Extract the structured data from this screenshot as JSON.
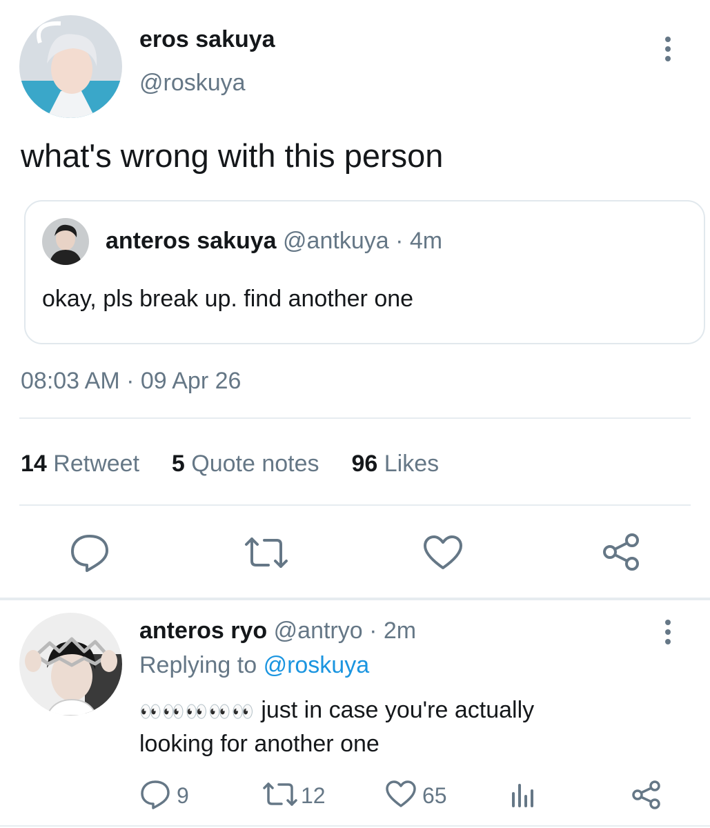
{
  "main_tweet": {
    "display_name": "eros sakuya",
    "handle": "@roskuya",
    "text": "what's wrong with this person",
    "quoted": {
      "display_name": "anteros sakuya",
      "handle": "@antkuya",
      "time_sep": "·",
      "time": "4m",
      "text": "okay, pls break up. find another one"
    },
    "timestamp": "08:03 AM · 09 Apr 26",
    "stats": {
      "retweets_count": "14",
      "retweets_label": "Retweet",
      "quotes_count": "5",
      "quotes_label": "Quote notes",
      "likes_count": "96",
      "likes_label": "Likes"
    },
    "actions": [
      "reply-icon",
      "retweet-icon",
      "heart-icon",
      "share-icon"
    ]
  },
  "reply_tweet": {
    "display_name": "anteros ryo",
    "handle": "@antryo",
    "time_sep": "·",
    "time": "2m",
    "replying_prefix": "Replying to",
    "replying_handle": "@roskuya",
    "emoji": "👀👀👀👀👀",
    "text_line1": " just in case you're actually",
    "text_line2": "looking for another one",
    "reply_count": "9",
    "retweet_count": "12",
    "like_count": "65",
    "actions": [
      "reply-icon",
      "retweet-icon",
      "heart-icon",
      "analytics-icon",
      "share-icon"
    ]
  },
  "colors": {
    "text": "#14171a",
    "secondary": "#657786",
    "link": "#1b95e0",
    "divider": "#e6ecf0"
  }
}
